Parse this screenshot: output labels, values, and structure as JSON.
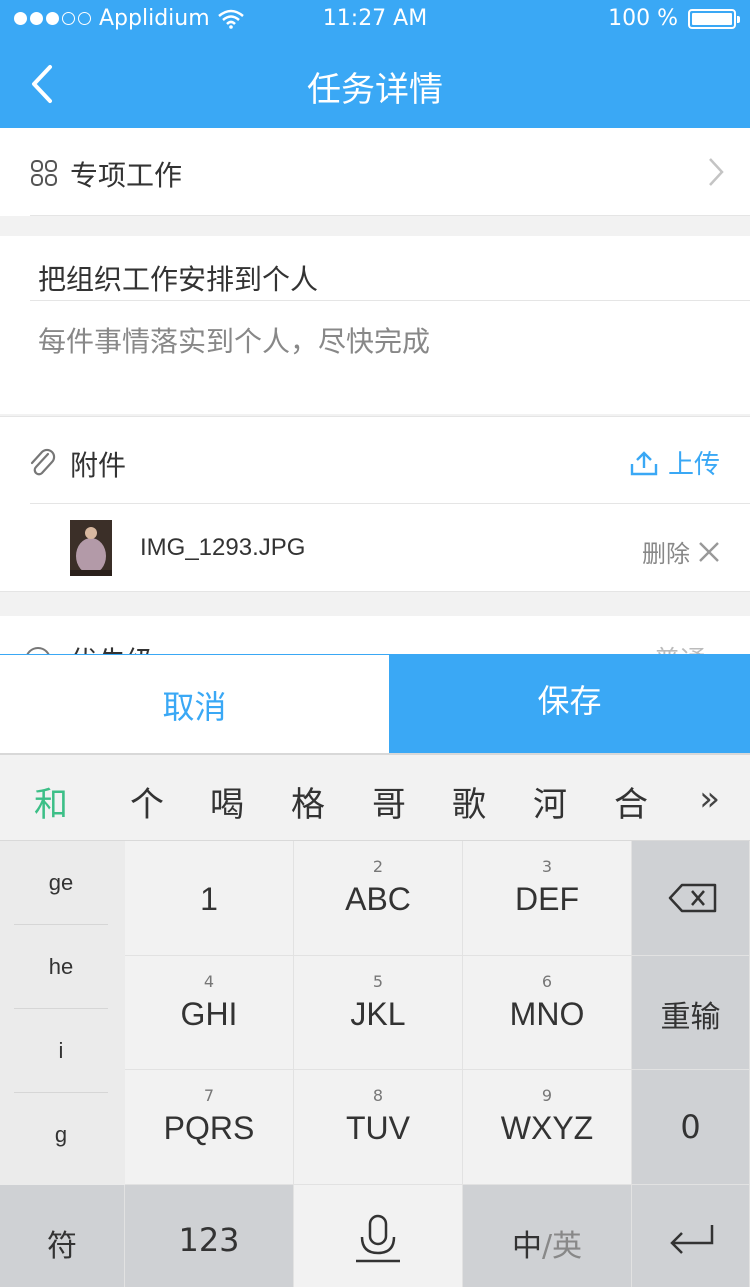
{
  "status_bar": {
    "carrier": "Applidium",
    "time": "11:27 AM",
    "battery": "100 %"
  },
  "header": {
    "title": "任务详情"
  },
  "task_type": {
    "label": "专项工作"
  },
  "task": {
    "title": "把组织工作安排到个人",
    "description": "每件事情落实到个人，尽快完成"
  },
  "attachments": {
    "label": "附件",
    "upload_label": "上传",
    "files": [
      {
        "name": "IMG_1293.JPG",
        "delete_label": "删除"
      }
    ]
  },
  "priority": {
    "label": "优先级",
    "value": "普通"
  },
  "actions": {
    "cancel_label": "取消",
    "save_label": "保存"
  },
  "keyboard": {
    "candidates": [
      "和",
      "个",
      "喝",
      "格",
      "哥",
      "歌",
      "河",
      "合"
    ],
    "more_label": "»",
    "pinyin_options": [
      "ge",
      "he",
      "i",
      "g"
    ],
    "keys": {
      "k1": {
        "num": "",
        "letters": "1"
      },
      "k2": {
        "num": "2",
        "letters": "ABC"
      },
      "k3": {
        "num": "3",
        "letters": "DEF"
      },
      "k4": {
        "num": "4",
        "letters": "GHI"
      },
      "k5": {
        "num": "5",
        "letters": "JKL"
      },
      "k6": {
        "num": "6",
        "letters": "MNO"
      },
      "k7": {
        "num": "7",
        "letters": "PQRS"
      },
      "k8": {
        "num": "8",
        "letters": "TUV"
      },
      "k9": {
        "num": "9",
        "letters": "WXYZ"
      }
    },
    "reinput_label": "重输",
    "zero_label": "0",
    "symbol_label": "符",
    "numeric_label": "123",
    "lang_cn": "中",
    "lang_sep": "/",
    "lang_en": "英"
  },
  "colors": {
    "accent": "#3aa8f5",
    "candidate_highlight": "#3cbf87"
  }
}
